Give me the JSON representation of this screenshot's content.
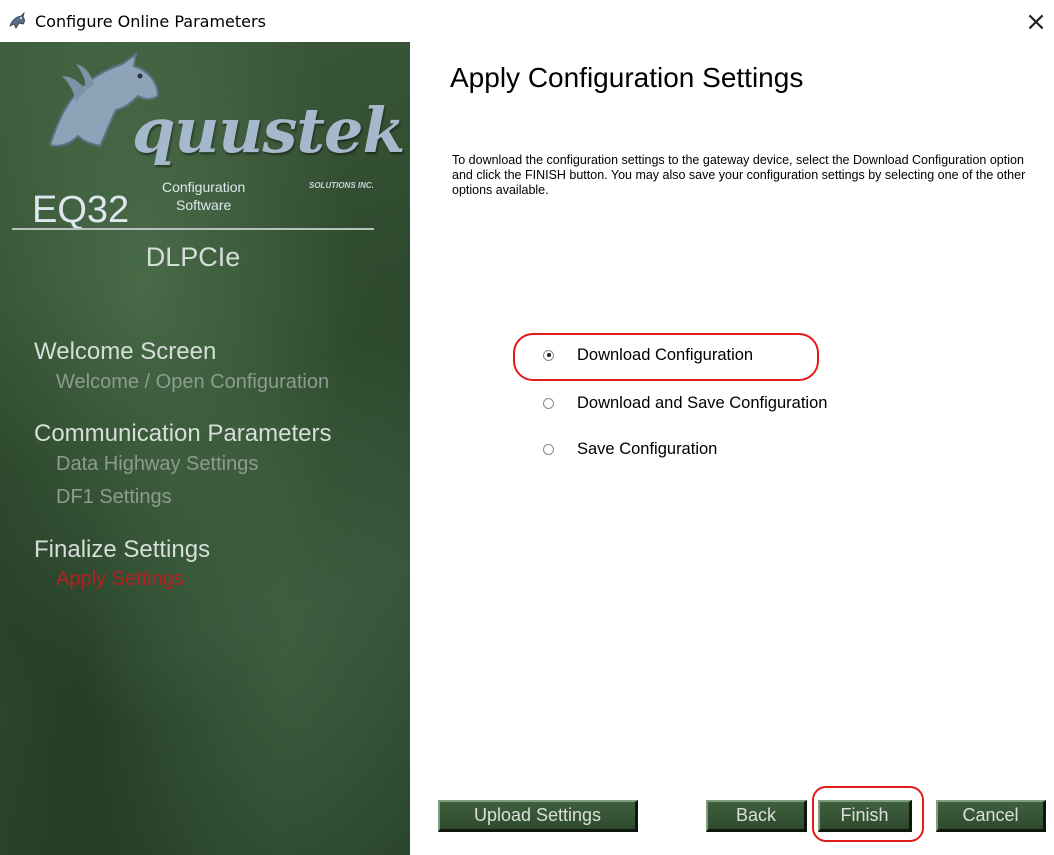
{
  "window": {
    "title": "Configure Online Parameters",
    "close_glyph": "×"
  },
  "sidebar": {
    "logo_word": "quustek",
    "logo_sub": "SOLUTIONS INC.",
    "product": "EQ32",
    "product_sub_1": "Configuration",
    "product_sub_2": "Software",
    "device": "DLPCIe",
    "sections": [
      {
        "heading": "Welcome Screen",
        "items": [
          {
            "label": "Welcome / Open Configuration",
            "active": false
          }
        ]
      },
      {
        "heading": "Communication Parameters",
        "items": [
          {
            "label": "Data Highway Settings",
            "active": false
          },
          {
            "label": "DF1 Settings",
            "active": false
          }
        ]
      },
      {
        "heading": "Finalize Settings",
        "items": [
          {
            "label": "Apply Settings",
            "active": true
          }
        ]
      }
    ]
  },
  "main": {
    "heading": "Apply Configuration Settings",
    "description": "To download the configuration settings to the gateway device, select the Download Configuration option and click the FINISH button.  You may also save your configuration settings by selecting one of the other options available.",
    "options": [
      {
        "label": "Download Configuration",
        "checked": true
      },
      {
        "label": "Download and Save Configuration",
        "checked": false
      },
      {
        "label": "Save Configuration",
        "checked": false
      }
    ]
  },
  "buttons": {
    "upload": "Upload Settings",
    "back": "Back",
    "finish": "Finish",
    "cancel": "Cancel"
  },
  "colors": {
    "highlight": "#e11a1a",
    "active_nav": "#b52121"
  }
}
